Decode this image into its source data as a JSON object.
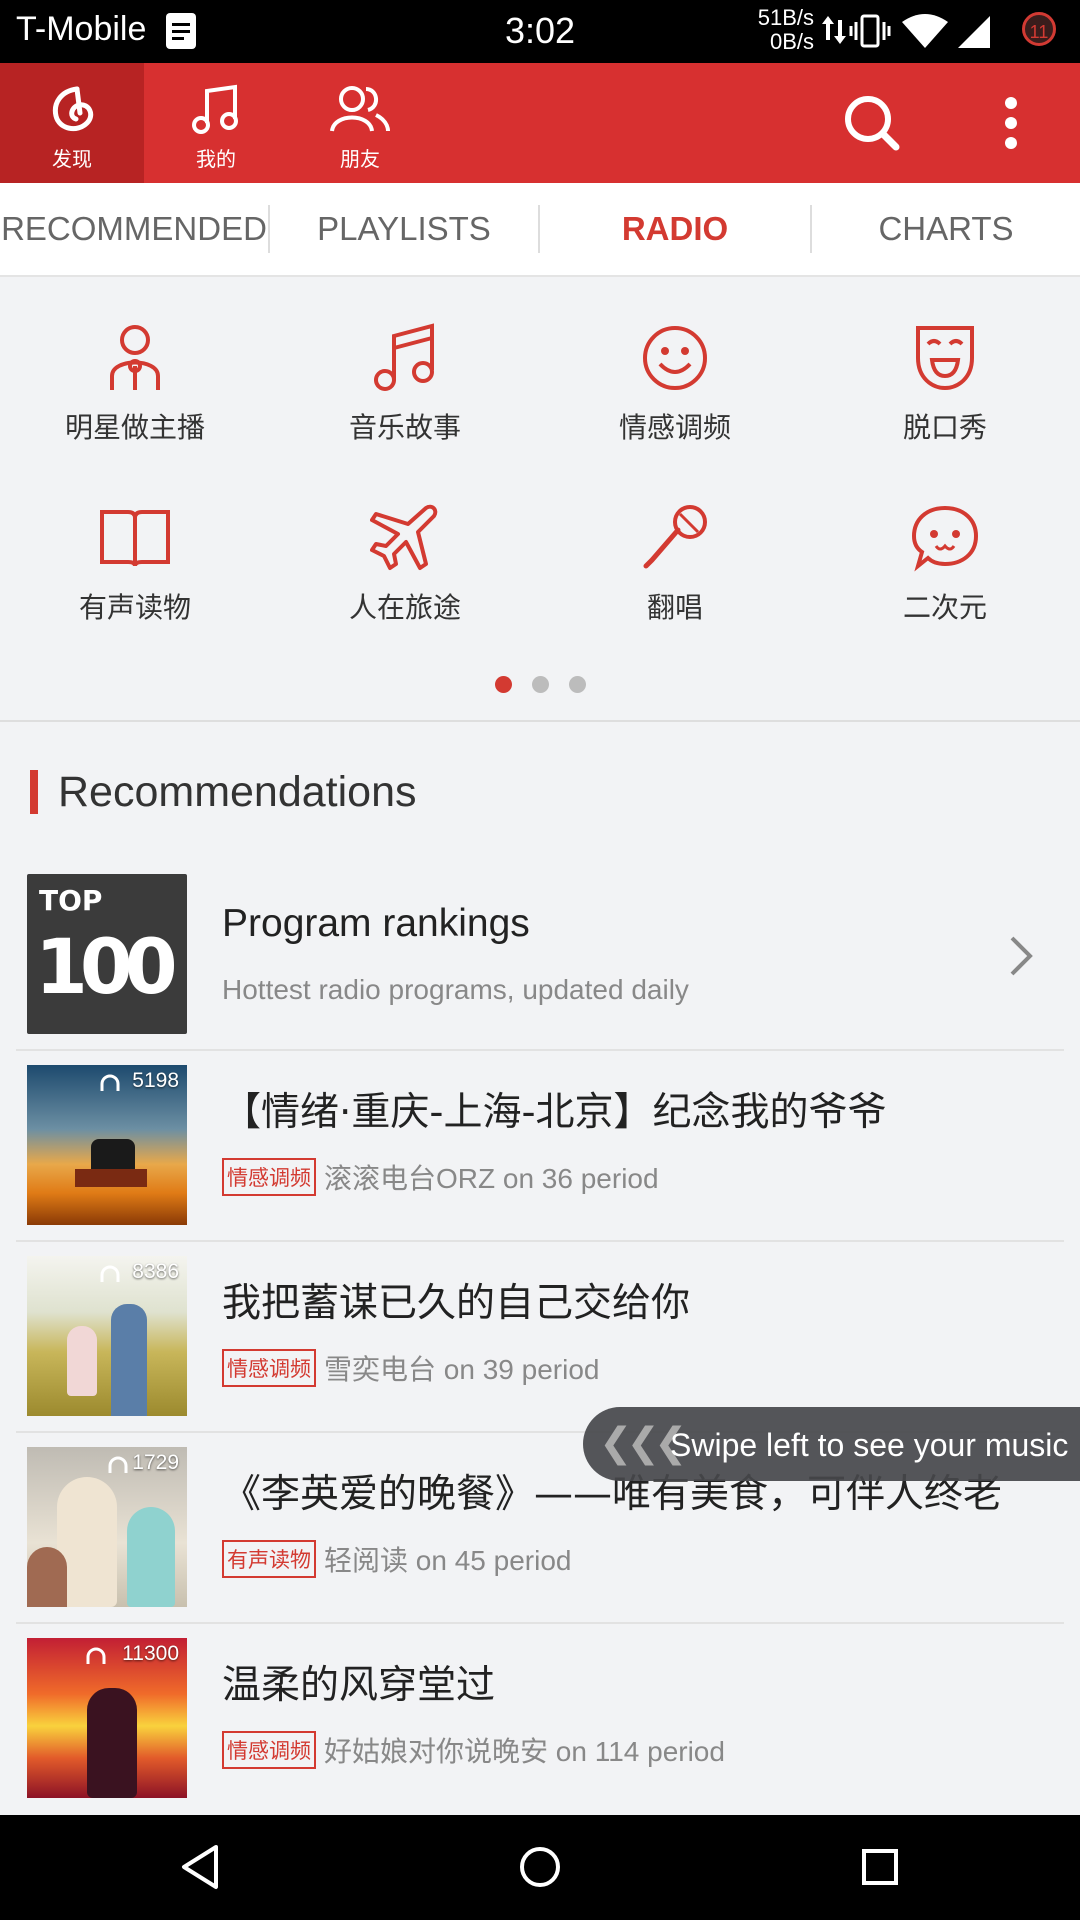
{
  "status_bar": {
    "carrier": "T-Mobile",
    "time": "3:02",
    "net_up": "51B/s",
    "net_down": "0B/s",
    "notification_count": "11"
  },
  "top_nav": {
    "tabs": [
      {
        "label": "发现",
        "icon": "netease-music-logo-icon"
      },
      {
        "label": "我的",
        "icon": "music-note-icon"
      },
      {
        "label": "朋友",
        "icon": "friends-icon"
      }
    ]
  },
  "sub_tabs": [
    "RECOMMENDED",
    "PLAYLISTS",
    "RADIO",
    "CHARTS"
  ],
  "categories": [
    {
      "label": "明星做主播",
      "icon": "host-person-icon"
    },
    {
      "label": "音乐故事",
      "icon": "music-note-icon"
    },
    {
      "label": "情感调频",
      "icon": "smiley-face-icon"
    },
    {
      "label": "脱口秀",
      "icon": "comedy-mask-icon"
    },
    {
      "label": "有声读物",
      "icon": "open-book-icon"
    },
    {
      "label": "人在旅途",
      "icon": "airplane-icon"
    },
    {
      "label": "翻唱",
      "icon": "microphone-icon"
    },
    {
      "label": "二次元",
      "icon": "anime-face-icon"
    }
  ],
  "pager": {
    "total": 3,
    "active": 1
  },
  "recommendations": {
    "title": "Recommendations",
    "ranking": {
      "title": "Program rankings",
      "subtitle": "Hottest radio programs, updated daily",
      "thumb_top": "TOP",
      "thumb_num": "100"
    },
    "items": [
      {
        "title": "【情绪·重庆-上海-北京】纪念我的爷爷",
        "tag": "情感调频",
        "meta": "滚滚电台ORZ on 36 period",
        "count": "5198"
      },
      {
        "title": "我把蓄谋已久的自己交给你",
        "tag": "情感调频",
        "meta": "雪奕电台 on 39 period",
        "count": "8386"
      },
      {
        "title": "《李英爱的晚餐》——唯有美食，可伴人终老",
        "tag": "有声读物",
        "meta": "轻阅读 on 45 period",
        "count": "1729"
      },
      {
        "title": "温柔的风穿堂过",
        "tag": "情感调频",
        "meta": "好姑娘对你说晚安 on 114 period",
        "count": "11300"
      }
    ]
  },
  "swipe_hint": "Swipe left to see your music",
  "colors": {
    "brand_red": "#d73030",
    "accent": "#d33a31"
  }
}
